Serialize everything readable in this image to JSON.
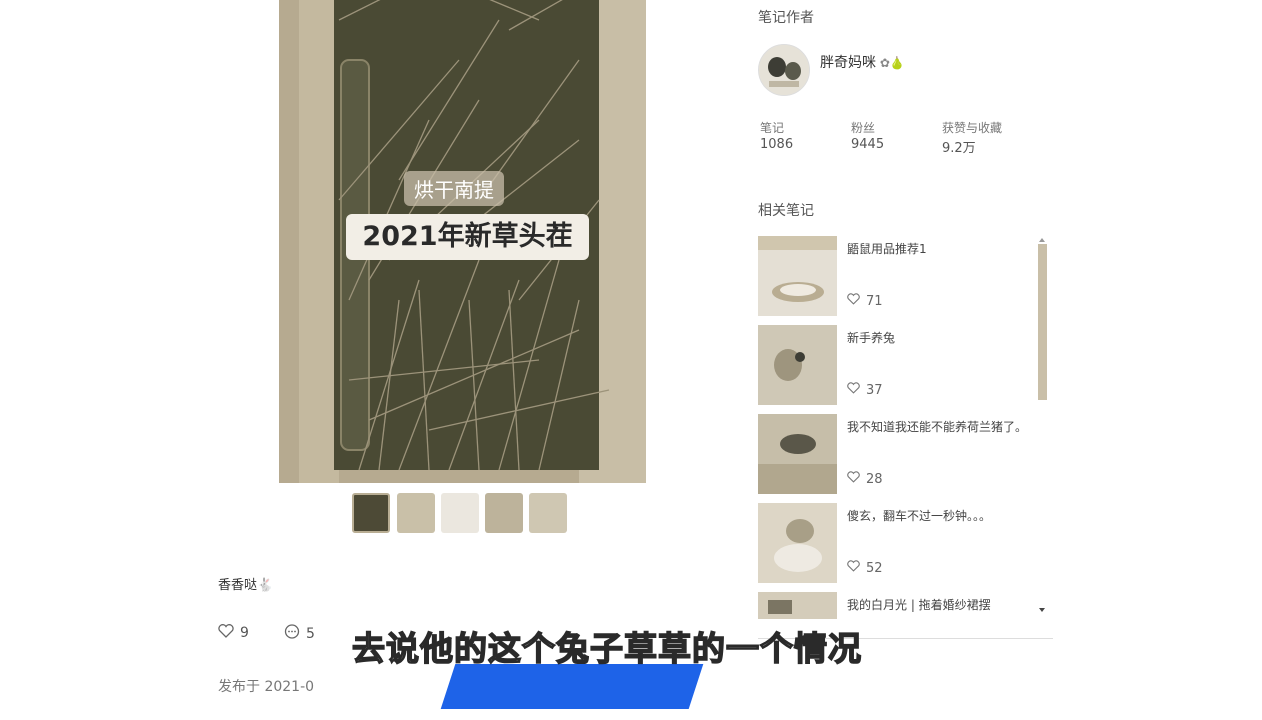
{
  "post": {
    "overlay_tag": "烘干南提",
    "overlay_title": "2021年新草头茬",
    "author_tag": "香香哒",
    "likes": "9",
    "comments": "5",
    "publish_date": "发布于 2021-0"
  },
  "author_section": {
    "title": "笔记作者",
    "name": "胖奇妈咪",
    "stats": [
      {
        "label": "笔记",
        "value": "1086"
      },
      {
        "label": "粉丝",
        "value": "9445"
      },
      {
        "label": "获赞与收藏",
        "value": "9.2万"
      }
    ]
  },
  "related": {
    "title": "相关笔记",
    "items": [
      {
        "title": "鼯鼠用品推荐1",
        "likes": "71"
      },
      {
        "title": "新手养兔",
        "likes": "37"
      },
      {
        "title": "我不知道我还能不能养荷兰猪了。",
        "likes": "28"
      },
      {
        "title": "傻玄，翻车不过一秒钟。。。",
        "likes": "52"
      },
      {
        "title": "我的白月光 | 拖着婚纱裙摆",
        "likes": ""
      }
    ]
  },
  "subtitle": "去说他的这个兔子草草的一个情况",
  "colors": {
    "accent_blue": "#1e63e8",
    "image_tone": "#b8ab91"
  }
}
